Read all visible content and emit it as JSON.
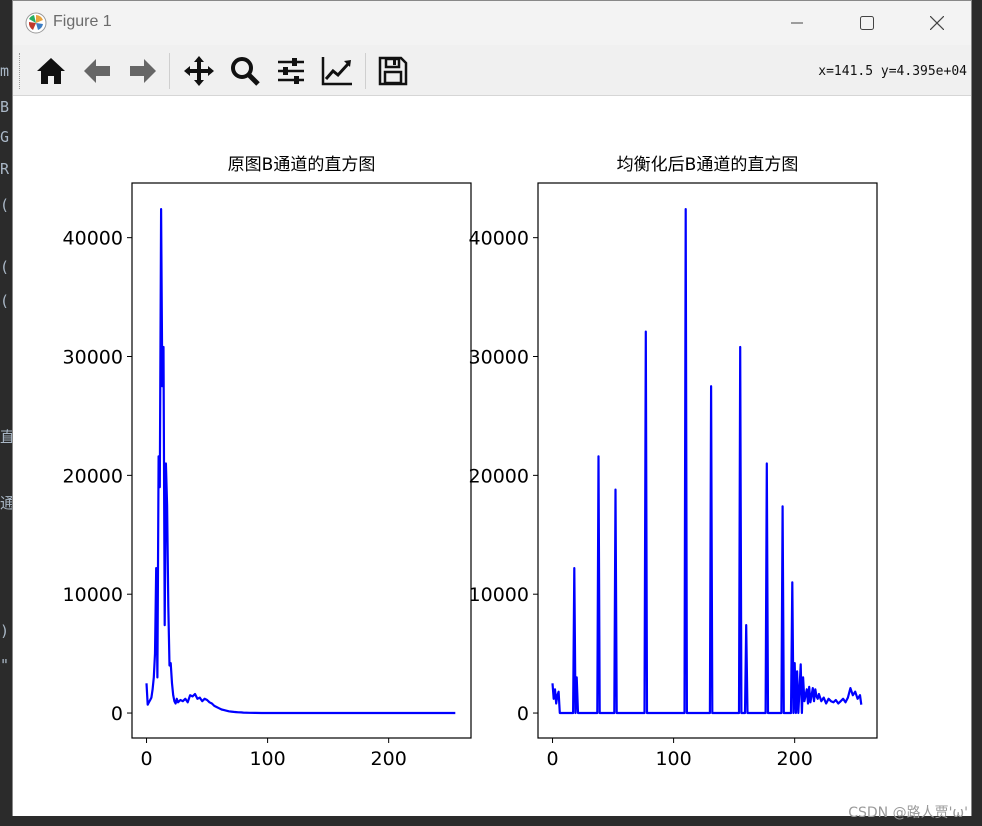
{
  "window": {
    "title": "Figure 1"
  },
  "status": {
    "coords": "x=141.5 y=4.395e+04"
  },
  "watermark": "CSDN @路人贾'ω'",
  "toolbar": [
    "home-icon",
    "back-arrow-icon",
    "forward-arrow-icon",
    "pan-icon",
    "zoom-icon",
    "configure-subplots-icon",
    "edit-axis-icon",
    "save-icon"
  ],
  "editor_fragments": [
    "m",
    "B",
    "G",
    "R",
    "(",
    "(",
    "(",
    "直",
    "通",
    ")",
    "\""
  ],
  "colors": {
    "line": "#0000ff",
    "accent": "#0000ff"
  },
  "chart_data": [
    {
      "type": "line",
      "title": "原图B通道的直方图",
      "xlabel": "",
      "ylabel": "",
      "xlim": [
        -12,
        268
      ],
      "ylim": [
        -2100,
        44600
      ],
      "xticks": [
        0,
        100,
        200
      ],
      "yticks": [
        0,
        10000,
        20000,
        30000,
        40000
      ],
      "series": [
        {
          "color": "#0000ff",
          "x": [
            0,
            1,
            2,
            3,
            4,
            5,
            6,
            7,
            8,
            9,
            10,
            11,
            12,
            13,
            14,
            15,
            16,
            17,
            18,
            19,
            20,
            21,
            22,
            23,
            24,
            25,
            26,
            28,
            30,
            32,
            34,
            36,
            38,
            40,
            42,
            44,
            46,
            48,
            50,
            52,
            54,
            56,
            58,
            60,
            62,
            64,
            66,
            68,
            70,
            72,
            74,
            76,
            78,
            80,
            85,
            90,
            95,
            100,
            110,
            120,
            150,
            200,
            255
          ],
          "y": [
            2500,
            700,
            900,
            1100,
            1300,
            2000,
            3000,
            5000,
            12200,
            3000,
            21600,
            19000,
            42400,
            27500,
            30800,
            7400,
            21000,
            17500,
            9000,
            4000,
            4200,
            2500,
            1500,
            1000,
            800,
            1200,
            900,
            1100,
            1000,
            1200,
            900,
            1500,
            1400,
            1600,
            1200,
            1300,
            1000,
            1200,
            1100,
            900,
            800,
            600,
            500,
            400,
            300,
            250,
            200,
            150,
            120,
            100,
            80,
            60,
            50,
            40,
            20,
            10,
            5,
            2,
            0,
            0,
            0,
            0,
            0
          ]
        }
      ]
    },
    {
      "type": "line",
      "title": "均衡化后B通道的直方图",
      "xlabel": "",
      "ylabel": "",
      "xlim": [
        -12,
        268
      ],
      "ylim": [
        -2100,
        44600
      ],
      "xticks": [
        0,
        100,
        200
      ],
      "yticks": [
        0,
        10000,
        20000,
        30000,
        40000
      ],
      "series": [
        {
          "color": "#0000ff",
          "x": [
            0,
            1,
            2,
            3,
            4,
            5,
            6,
            7,
            8,
            17,
            18,
            19,
            20,
            21,
            22,
            37,
            38,
            39,
            51,
            52,
            53,
            76,
            77,
            78,
            109,
            110,
            111,
            130,
            131,
            132,
            154,
            155,
            156,
            159,
            160,
            161,
            176,
            177,
            178,
            189,
            190,
            191,
            197,
            198,
            199,
            200,
            201,
            202,
            203,
            204,
            205,
            206,
            207,
            208,
            209,
            210,
            211,
            212,
            213,
            214,
            215,
            216,
            217,
            218,
            219,
            220,
            222,
            224,
            226,
            228,
            230,
            232,
            234,
            236,
            238,
            240,
            242,
            244,
            246,
            248,
            250,
            252,
            254,
            255
          ],
          "y": [
            2500,
            1200,
            2000,
            800,
            1500,
            1800,
            0,
            0,
            0,
            0,
            12200,
            0,
            3000,
            0,
            0,
            0,
            21600,
            0,
            0,
            18800,
            0,
            0,
            32100,
            0,
            0,
            42400,
            0,
            0,
            27500,
            0,
            0,
            30800,
            0,
            0,
            7400,
            0,
            0,
            21000,
            0,
            0,
            17400,
            0,
            0,
            11000,
            0,
            4200,
            0,
            3500,
            0,
            2000,
            4100,
            0,
            3000,
            1000,
            1500,
            2000,
            800,
            2200,
            900,
            1500,
            2100,
            1000,
            2000,
            1400,
            1200,
            1600,
            1000,
            1300,
            800,
            1200,
            1000,
            900,
            1100,
            800,
            1000,
            1200,
            900,
            1300,
            2100,
            1500,
            1800,
            1200,
            1500,
            700
          ]
        }
      ]
    }
  ]
}
